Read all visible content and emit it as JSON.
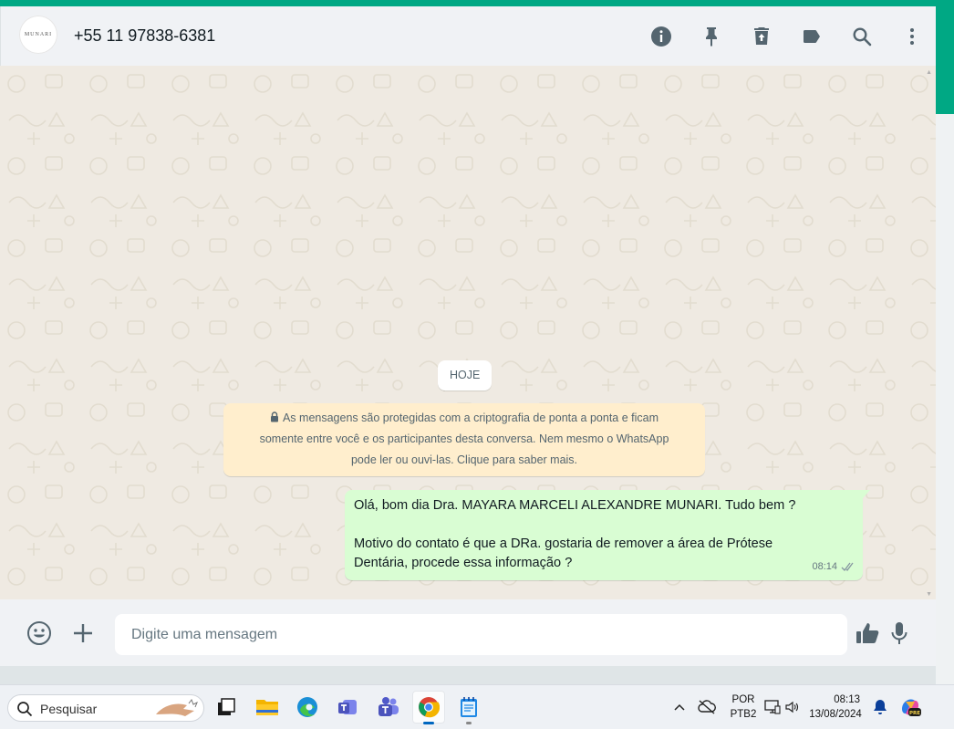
{
  "header": {
    "avatar_text": "MUNARI",
    "contact_name": "+55 11 97838-6381"
  },
  "chat": {
    "date_pill": "HOJE",
    "encryption_notice": {
      "line1": "As mensagens são protegidas com a criptografia de ponta a ponta e ficam",
      "line2": "somente entre você e os participantes desta conversa. Nem mesmo o WhatsApp",
      "line3": "pode ler ou ouvi-las. Clique para saber mais."
    },
    "messages": [
      {
        "line1": "Olá, bom dia Dra. MAYARA MARCELI ALEXANDRE MUNARI. Tudo bem ?",
        "line2": "Motivo do contato é que a DRa. gostaria de remover a área de Prótese",
        "line3": "Dentária, procede essa informação ?",
        "time": "08:14",
        "status": "delivered"
      }
    ]
  },
  "composer": {
    "placeholder": "Digite uma mensagem"
  },
  "taskbar": {
    "search_label": "Pesquisar",
    "language": "POR",
    "layout": "PTB2",
    "time": "08:13",
    "date": "13/08/2024"
  },
  "colors": {
    "brand": "#00a884",
    "chat_bg": "#efeae2",
    "outgoing_bubble": "#d9fdd3",
    "system_notice": "#ffeecd",
    "icon": "#54656f"
  }
}
